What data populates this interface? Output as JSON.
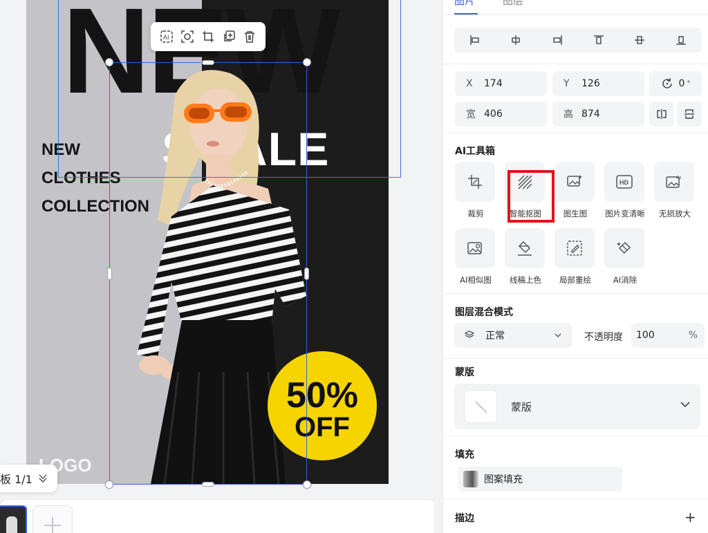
{
  "panel": {
    "tabs": [
      "图片",
      "图层"
    ],
    "position": {
      "x_label": "X",
      "x_value": "174",
      "y_label": "Y",
      "y_value": "126"
    },
    "rotation": {
      "value": "0",
      "unit": "°"
    },
    "size": {
      "w_label": "宽",
      "w_value": "406",
      "h_label": "高",
      "h_value": "874"
    },
    "ai_toolbox": {
      "title": "AI工具箱",
      "tools": [
        {
          "label": "裁剪",
          "icon": "crop-icon"
        },
        {
          "label": "智能抠图",
          "icon": "smart-cutout-icon"
        },
        {
          "label": "图生图",
          "icon": "image-to-image-icon"
        },
        {
          "label": "图片变清晰",
          "icon": "hd-enhance-icon"
        },
        {
          "label": "无损放大",
          "icon": "upscale-4x-icon"
        },
        {
          "label": "AI相似图",
          "icon": "similar-image-icon"
        },
        {
          "label": "线稿上色",
          "icon": "lineart-colorize-icon"
        },
        {
          "label": "局部重绘",
          "icon": "inpaint-icon"
        },
        {
          "label": "AI消除",
          "icon": "ai-erase-icon"
        }
      ]
    },
    "blend": {
      "title": "图层混合模式",
      "mode": "正常",
      "opacity_label": "不透明度",
      "opacity_value": "100",
      "opacity_unit": "%"
    },
    "mask": {
      "title": "蒙版",
      "label": "蒙版"
    },
    "fill": {
      "title": "填充",
      "label": "图案填充"
    },
    "stroke": {
      "title": "描边",
      "add_symbol": "+"
    }
  },
  "canvas": {
    "poster": {
      "headline": "NEW",
      "side_lines": [
        "NEW",
        "CLOTHES",
        "COLLECTION"
      ],
      "sale_text": "S   ALE",
      "badge_pct": "50%",
      "badge_off": "OFF",
      "logo": "LOGO"
    },
    "page_indicator": "板 1/1"
  },
  "colors": {
    "accent": "#3d5af1",
    "selection": "#2f62e6",
    "highlight": "#e3121b",
    "badge": "#f6d400"
  }
}
